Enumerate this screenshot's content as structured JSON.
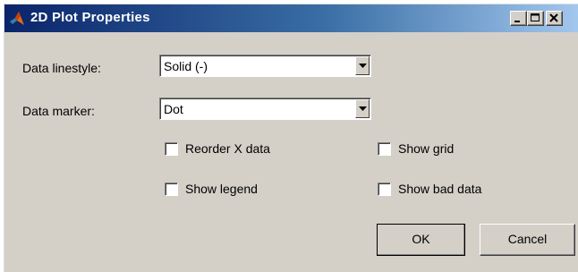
{
  "window": {
    "title": "2D Plot Properties",
    "titlebar_colors": [
      "#0a246a",
      "#3a6ea5",
      "#a6caf0"
    ]
  },
  "fields": {
    "linestyle_label": "Data linestyle:",
    "linestyle_value": "Solid (-)",
    "marker_label": "Data marker:",
    "marker_value": "Dot"
  },
  "options": {
    "reorder_x": "Reorder X data",
    "show_grid": "Show grid",
    "show_legend": "Show legend",
    "show_bad_data": "Show bad data"
  },
  "buttons": {
    "ok": "OK",
    "cancel": "Cancel"
  }
}
